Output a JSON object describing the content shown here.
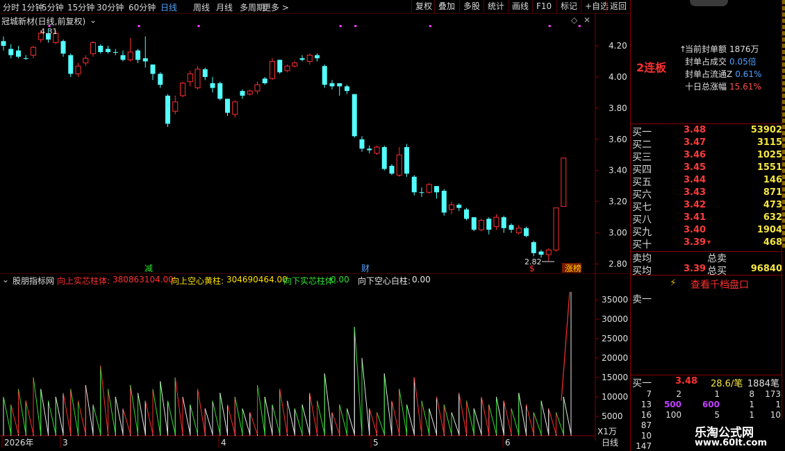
{
  "toolbar": {
    "periods": [
      "分时",
      "1分钟",
      "5分钟",
      "15分钟",
      "30分钟",
      "60分钟",
      "日线",
      "周线",
      "月线",
      "多周期",
      "更多 >"
    ],
    "active_period": "日线",
    "right_buttons": [
      "复权",
      "叠加",
      "多股",
      "统计",
      "画线",
      "F10",
      "标记",
      "+自选",
      "返回"
    ]
  },
  "main_chart": {
    "title": "冠城新材(日线,前复权)",
    "high_marker": "4.31",
    "low_marker": "2.82",
    "event_markers": [
      "减",
      "财",
      "$",
      "涨榜"
    ],
    "y_ticks": [
      "4.20",
      "4.00",
      "3.80",
      "3.60",
      "3.40",
      "3.20",
      "3.00",
      "2.80"
    ],
    "y_values": [
      4.2,
      4.0,
      3.8,
      3.6,
      3.4,
      3.2,
      3.0,
      2.8
    ],
    "candles": [
      [
        4.23,
        4.2,
        4.26,
        4.17,
        "dn"
      ],
      [
        4.18,
        4.14,
        4.21,
        4.12,
        "dn"
      ],
      [
        4.17,
        4.13,
        4.2,
        4.12,
        "dn"
      ],
      [
        4.12,
        4.12,
        4.14,
        4.11,
        "dn"
      ],
      [
        4.14,
        4.19,
        4.2,
        4.12,
        "up"
      ],
      [
        4.24,
        4.28,
        4.3,
        4.22,
        "up"
      ],
      [
        4.28,
        4.24,
        4.31,
        4.22,
        "dn"
      ],
      [
        4.22,
        4.28,
        4.3,
        4.21,
        "up"
      ],
      [
        4.23,
        4.15,
        4.24,
        4.13,
        "dn"
      ],
      [
        4.14,
        4.02,
        4.15,
        4.0,
        "dn"
      ],
      [
        4.02,
        4.07,
        4.09,
        4.0,
        "up"
      ],
      [
        4.09,
        4.12,
        4.14,
        4.07,
        "up"
      ],
      [
        4.15,
        4.22,
        4.23,
        4.13,
        "up"
      ],
      [
        4.2,
        4.16,
        4.21,
        4.15,
        "dn"
      ],
      [
        4.18,
        4.16,
        4.2,
        4.15,
        "dn"
      ],
      [
        4.16,
        4.16,
        4.18,
        4.14,
        "dn"
      ],
      [
        4.14,
        4.11,
        4.17,
        4.1,
        "dn"
      ],
      [
        4.11,
        4.16,
        4.25,
        4.1,
        "up"
      ],
      [
        4.17,
        4.11,
        4.18,
        4.09,
        "dn"
      ],
      [
        4.12,
        4.1,
        4.26,
        4.06,
        "dn"
      ],
      [
        4.08,
        4.02,
        4.08,
        3.98,
        "dn"
      ],
      [
        4.02,
        3.95,
        4.03,
        3.93,
        "dn"
      ],
      [
        3.88,
        3.7,
        3.89,
        3.68,
        "dn"
      ],
      [
        3.78,
        3.84,
        3.88,
        3.76,
        "up"
      ],
      [
        3.88,
        3.96,
        3.97,
        3.87,
        "up"
      ],
      [
        3.97,
        4.02,
        4.04,
        3.94,
        "up"
      ],
      [
        3.93,
        4.05,
        4.07,
        3.92,
        "up"
      ],
      [
        4.05,
        4.0,
        4.06,
        3.98,
        "dn"
      ],
      [
        3.96,
        3.93,
        4.0,
        3.9,
        "dn"
      ],
      [
        3.96,
        3.86,
        3.97,
        3.85,
        "dn"
      ],
      [
        3.86,
        3.77,
        3.86,
        3.75,
        "dn"
      ],
      [
        3.76,
        3.84,
        3.85,
        3.74,
        "up"
      ],
      [
        3.91,
        3.88,
        3.92,
        3.86,
        "dn"
      ],
      [
        3.89,
        3.91,
        3.92,
        3.88,
        "up"
      ],
      [
        3.91,
        3.95,
        3.97,
        3.89,
        "up"
      ],
      [
        3.99,
        3.96,
        4.0,
        3.95,
        "dn"
      ],
      [
        3.99,
        4.1,
        4.12,
        3.98,
        "up"
      ],
      [
        4.11,
        4.03,
        4.11,
        4.02,
        "dn"
      ],
      [
        4.04,
        4.07,
        4.08,
        4.03,
        "up"
      ],
      [
        4.07,
        4.09,
        4.1,
        4.06,
        "up"
      ],
      [
        4.12,
        4.11,
        4.14,
        4.1,
        "dn"
      ],
      [
        4.1,
        4.14,
        4.15,
        4.08,
        "up"
      ],
      [
        4.14,
        4.12,
        4.15,
        4.1,
        "dn"
      ],
      [
        4.07,
        3.95,
        4.08,
        3.93,
        "dn"
      ],
      [
        3.96,
        3.94,
        3.98,
        3.92,
        "dn"
      ],
      [
        3.96,
        3.94,
        3.96,
        3.88,
        "dn"
      ],
      [
        3.94,
        3.91,
        3.95,
        3.89,
        "dn"
      ],
      [
        3.89,
        3.62,
        3.89,
        3.61,
        "dn"
      ],
      [
        3.6,
        3.54,
        3.62,
        3.52,
        "dn"
      ],
      [
        3.54,
        3.53,
        3.56,
        3.51,
        "dn"
      ],
      [
        3.51,
        3.55,
        3.56,
        3.5,
        "up"
      ],
      [
        3.55,
        3.41,
        3.56,
        3.4,
        "dn"
      ],
      [
        3.43,
        3.38,
        3.44,
        3.37,
        "dn"
      ],
      [
        3.37,
        3.5,
        3.55,
        3.36,
        "up"
      ],
      [
        3.55,
        3.38,
        3.57,
        3.36,
        "dn"
      ],
      [
        3.36,
        3.26,
        3.37,
        3.24,
        "dn"
      ],
      [
        3.26,
        3.26,
        3.29,
        3.23,
        "dn"
      ],
      [
        3.26,
        3.31,
        3.32,
        3.25,
        "up"
      ],
      [
        3.3,
        3.26,
        3.3,
        3.22,
        "dn"
      ],
      [
        3.27,
        3.13,
        3.28,
        3.11,
        "dn"
      ],
      [
        3.15,
        3.18,
        3.2,
        3.12,
        "up"
      ],
      [
        3.18,
        3.16,
        3.19,
        3.14,
        "dn"
      ],
      [
        3.15,
        3.09,
        3.16,
        3.08,
        "dn"
      ],
      [
        3.1,
        3.02,
        3.1,
        3.01,
        "dn"
      ],
      [
        3.02,
        3.08,
        3.09,
        3.01,
        "up"
      ],
      [
        3.09,
        3.02,
        3.1,
        2.99,
        "dn"
      ],
      [
        3.04,
        3.1,
        3.12,
        3.02,
        "up"
      ],
      [
        3.1,
        3.03,
        3.11,
        3.0,
        "dn"
      ],
      [
        3.05,
        3.02,
        3.06,
        3.0,
        "dn"
      ],
      [
        3.0,
        3.03,
        3.05,
        2.99,
        "up"
      ],
      [
        3.03,
        2.98,
        3.04,
        2.97,
        "dn"
      ],
      [
        2.94,
        2.87,
        2.95,
        2.85,
        "dn"
      ],
      [
        2.88,
        2.86,
        2.89,
        2.84,
        "dn"
      ],
      [
        2.86,
        2.89,
        2.9,
        2.82,
        "up"
      ],
      [
        2.89,
        3.16,
        3.16,
        2.88,
        "up"
      ],
      [
        3.17,
        3.48,
        3.48,
        3.17,
        "up"
      ]
    ]
  },
  "indicator": {
    "name": "股朋指标网",
    "legend": [
      {
        "label": "向上实芯柱体:",
        "value": "380863104.00",
        "color": "#ff3030"
      },
      {
        "label": "向上空心黄柱:",
        "value": "304690464.00",
        "color": "#ffe000"
      },
      {
        "label": "向下实芯柱体:",
        "value": "0.00",
        "color": "#30e030"
      },
      {
        "label": "向下空心白柱:",
        "value": "0.00",
        "color": "#e8e8e8"
      }
    ],
    "unit": "X1万",
    "y_ticks": [
      "35000",
      "30000",
      "25000",
      "20000",
      "15000",
      "10000",
      "5000"
    ],
    "y_values": [
      35000,
      30000,
      25000,
      20000,
      15000,
      10000,
      5000
    ],
    "values": [
      10000,
      8000,
      12000,
      9000,
      15000,
      12000,
      9000,
      10000,
      11000,
      12000,
      9000,
      13000,
      8000,
      18000,
      12000,
      10000,
      7000,
      13000,
      11000,
      9000,
      12000,
      14000,
      9000,
      15000,
      10000,
      8000,
      12000,
      7000,
      9000,
      11000,
      8000,
      10000,
      7000,
      6000,
      13000,
      10000,
      8000,
      12000,
      9000,
      7000,
      8000,
      11000,
      9000,
      16000,
      6000,
      8000,
      7000,
      28000,
      20000,
      7000,
      6000,
      16000,
      9000,
      12000,
      8000,
      15000,
      9000,
      7000,
      10000,
      8000,
      6000,
      11000,
      9000,
      7000,
      10000,
      8000,
      10000,
      9000,
      7000,
      11000,
      8000,
      6000,
      9000,
      7000,
      6000,
      10000,
      37000
    ],
    "colors": [
      "g",
      "r",
      "g",
      "r",
      "g",
      "w",
      "g",
      "w",
      "r",
      "g",
      "r",
      "w",
      "g",
      "r",
      "g",
      "w",
      "r",
      "g",
      "w",
      "r",
      "g",
      "w",
      "g",
      "r",
      "w",
      "g",
      "r",
      "w",
      "g",
      "w",
      "r",
      "g",
      "w",
      "r",
      "g",
      "w",
      "g",
      "r",
      "w",
      "g",
      "w",
      "r",
      "g",
      "w",
      "r",
      "g",
      "w",
      "g",
      "w",
      "r",
      "g",
      "w",
      "r",
      "g",
      "w",
      "r",
      "g",
      "w",
      "r",
      "g",
      "w",
      "r",
      "g",
      "w",
      "r",
      "g",
      "w",
      "r",
      "g",
      "w",
      "r",
      "g",
      "w",
      "r",
      "g",
      "w",
      "r"
    ],
    "x_labels": [
      "2026年",
      "3",
      "4",
      "5",
      "6"
    ],
    "period_label": "日线"
  },
  "right_panel": {
    "board": "2连板",
    "stats": [
      {
        "label": "当前封单额",
        "value": "1876万"
      },
      {
        "label": "封单占成交",
        "value": "0.05倍"
      },
      {
        "label": "封单占流通Z",
        "value": "0.61%"
      },
      {
        "label": "十日总涨幅",
        "value": "15.61%"
      }
    ],
    "bids": [
      {
        "label": "买一",
        "price": "3.48",
        "vol": "53902"
      },
      {
        "label": "买二",
        "price": "3.47",
        "vol": "3115"
      },
      {
        "label": "买三",
        "price": "3.46",
        "vol": "1025"
      },
      {
        "label": "买四",
        "price": "3.45",
        "vol": "1551"
      },
      {
        "label": "买五",
        "price": "3.44",
        "vol": "146"
      },
      {
        "label": "买六",
        "price": "3.43",
        "vol": "871"
      },
      {
        "label": "买七",
        "price": "3.42",
        "vol": "473"
      },
      {
        "label": "买八",
        "price": "3.41",
        "vol": "632"
      },
      {
        "label": "买九",
        "price": "3.40",
        "vol": "1904"
      },
      {
        "label": "买十",
        "price": "3.39",
        "vol": "468"
      }
    ],
    "sell_avg_label": "卖均",
    "total_sell_label": "总卖",
    "buy_avg_label": "买均",
    "buy_avg": "3.39",
    "total_buy_label": "总买",
    "total_buy": "96840",
    "ten_level_button": "查看千档盘口",
    "sell_one_label": "卖一",
    "buy_one_label": "买一",
    "buy_one_price": "3.48",
    "buy_one_per": "28.6/笔",
    "buy_one_count": "1884笔",
    "queue": [
      [
        "7",
        "2",
        "1",
        "8",
        "173"
      ],
      [
        "13",
        "500",
        "600",
        "1",
        "1"
      ],
      [
        "16",
        "100",
        "5",
        "1",
        "10"
      ],
      [
        "87",
        "",
        "",
        "",
        ""
      ],
      [
        "10",
        "",
        "",
        "",
        ""
      ],
      [
        "147",
        "",
        "",
        "",
        ""
      ]
    ],
    "watermark_title": "乐淘公式网",
    "watermark_url": "www.60lt.com"
  }
}
